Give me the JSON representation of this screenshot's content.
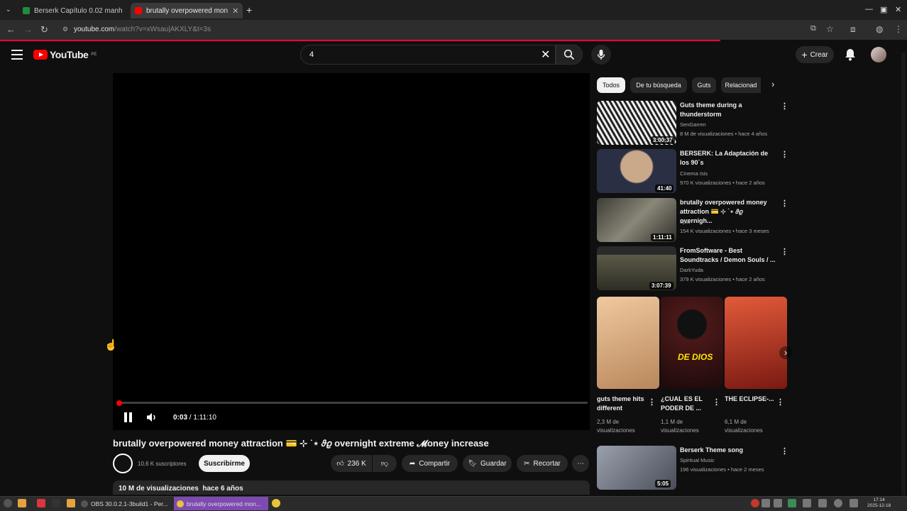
{
  "browser": {
    "tabs": [
      {
        "label": "Berserk Capítulo 0.02 manh",
        "favicon_color": "#1e8e3e",
        "active": false
      },
      {
        "label": "brutally overpowered mon",
        "favicon_color": "#ff0000",
        "active": true
      }
    ],
    "url_host": "youtube.com",
    "url_path": "/watch?v=xWsau|AKXLY&t=3s"
  },
  "header": {
    "logo_text": "YouTube",
    "logo_region": "PE",
    "search_value": "4",
    "create_label": "Crear"
  },
  "player": {
    "current_time": "0:03",
    "separator": " / ",
    "duration": "1:11:10",
    "progress_fraction": 0.0007
  },
  "video": {
    "title": "brutally overpowered money attraction 💳 ⊹ ˙⋆ 𝜗𝜚 overnight extreme 𝓜oney increase",
    "subscribers": "10,6 K suscriptores",
    "subscribe_label": "Suscribirme",
    "likes": "236 K",
    "share_label": "Compartir",
    "save_label": "Guardar",
    "clip_label": "Recortar",
    "views": "10 M de visualizaciones",
    "age": "hace 6 años"
  },
  "chips": [
    "Todos",
    "De tu búsqueda",
    "Guts",
    "Relacionad"
  ],
  "recommendations": [
    {
      "title": "Guts theme during a thunderstorm",
      "channel": "SenGarren",
      "meta": "8 M de visualizaciones • hace 4 años",
      "duration": "3:00:37",
      "thumb_color": "#d8d8d8"
    },
    {
      "title": "BERSERK: La Adaptación de los 90´s",
      "channel": "Cinema Isis",
      "meta": "970 K visualizaciones • hace 2 años",
      "duration": "41:40",
      "thumb_color": "#3b4a6b"
    },
    {
      "title": "brutally overpowered money attraction 💳 ⊹ ˙⋆ 𝜗𝜚 overnigh...",
      "channel": "opla",
      "meta": "154 K visualizaciones • hace 3 meses",
      "duration": "1:11:11",
      "thumb_color": "#5a5a52"
    },
    {
      "title": "FromSoftware - Best Soundtracks / Demon Souls / ...",
      "channel": "DarkYuda",
      "meta": "379 K visualizaciones • hace 2 años",
      "duration": "3:07:39",
      "thumb_color": "#4a4a3a"
    }
  ],
  "shorts": [
    {
      "title": "guts theme hits different",
      "views": "2,3 M de visualizaciones",
      "color": "#d9b48c"
    },
    {
      "title": "¿CUAL ES EL PODER DE ...",
      "views": "1,1 M de visualizaciones",
      "color": "#3a1414",
      "overlay": "DE DIOS"
    },
    {
      "title": "THE ECLIPSE-...",
      "views": "6,1 M de visualizaciones",
      "color": "#c43a2a"
    }
  ],
  "rec_after": {
    "title": "Berserk Theme song",
    "channel": "Spiritual Music",
    "meta": "196 visualizaciones • hace 2 meses",
    "duration": "5:05",
    "thumb_color": "#6b6f7a"
  },
  "taskbar": {
    "items": [
      {
        "label": "OBS 30.0.2.1-3build1 - Per...",
        "active": false
      },
      {
        "label": "brutally overpowered mon...",
        "active": true
      }
    ],
    "time": "17:14",
    "date": "2025-12-18"
  }
}
